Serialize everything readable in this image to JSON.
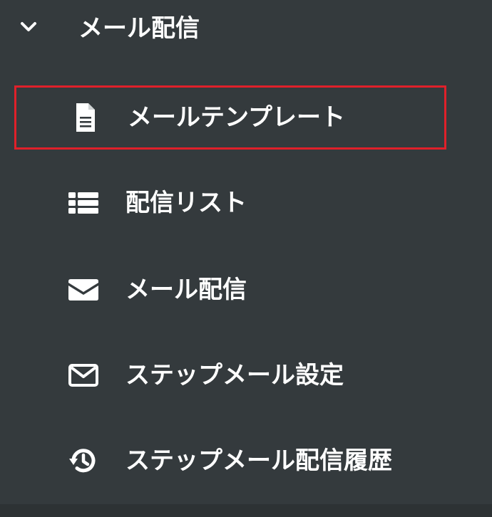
{
  "sidebar": {
    "section": {
      "title": "メール配信",
      "expanded": true,
      "chevron_icon": "chevron-down-icon"
    },
    "items": [
      {
        "label": "メールテンプレート",
        "icon": "file-icon",
        "selected": true
      },
      {
        "label": "配信リスト",
        "icon": "list-icon",
        "selected": false
      },
      {
        "label": "メール配信",
        "icon": "envelope-icon",
        "selected": false
      },
      {
        "label": "ステップメール設定",
        "icon": "envelope-outline-icon",
        "selected": false
      },
      {
        "label": "ステップメール配信履歴",
        "icon": "history-icon",
        "selected": false
      }
    ]
  },
  "colors": {
    "background": "#343a3d",
    "text": "#ffffff",
    "selection_border": "#e0202a"
  }
}
